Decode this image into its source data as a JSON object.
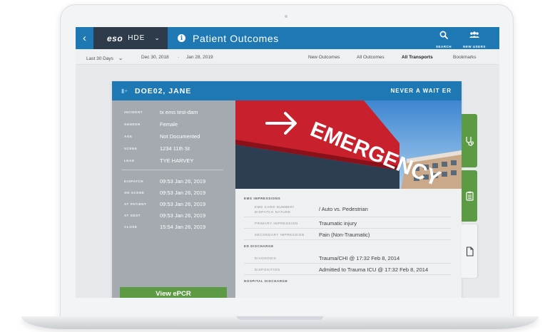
{
  "topbar": {
    "back_icon": "chevron-left-icon",
    "app_logo": "eso",
    "app_product": "HDE",
    "page_title": "Patient Outcomes",
    "actions": [
      {
        "label": "SEARCH",
        "icon": "search-icon"
      },
      {
        "label": "NEW USERS",
        "icon": "users-icon"
      }
    ]
  },
  "filters": {
    "range": "Last 30 Days",
    "start_date": "Dec 30, 2018",
    "separator": "-",
    "end_date": "Jan 28, 2019",
    "tabs": [
      "New Outcomes",
      "All Outcomes",
      "All Transports",
      "Bookmarks"
    ],
    "active_tab": "All Transports"
  },
  "patient": {
    "name": "DOE02, JANE",
    "facility": "NEVER A WAIT ER",
    "fields": [
      {
        "label": "INCIDENT",
        "value": "tx ems test-dam"
      },
      {
        "label": "GENDER",
        "value": "Female"
      },
      {
        "label": "AGE",
        "value": "Not Documented"
      },
      {
        "label": "SCENE",
        "value": "1234 11th St"
      },
      {
        "label": "LEAD",
        "value": "TYE HARVEY"
      }
    ],
    "times": [
      {
        "label": "DISPATCH",
        "value": "09:53 Jan 26, 2019"
      },
      {
        "label": "ON SCENE",
        "value": "09:53 Jan 26, 2019"
      },
      {
        "label": "AT PATIENT",
        "value": "09:53 Jan 26, 2019"
      },
      {
        "label": "AT DEST",
        "value": "09:53 Jan 26, 2019"
      },
      {
        "label": "CLOSE",
        "value": "15:54 Jan 26, 2019"
      }
    ],
    "view_button": "View ePCR"
  },
  "hero": {
    "sign_text": "EMERGENCY"
  },
  "details": {
    "ems_title": "EMS IMPRESSIONS",
    "ems": [
      {
        "label": "EMD CARD NUMBER/ DISPATCH NATURE",
        "value": "/ Auto vs. Pedestrian"
      },
      {
        "label": "PRIMARY IMPRESSION",
        "value": "Traumatic injury"
      },
      {
        "label": "SECONDARY IMPRESSION",
        "value": "Pain (Non-Traumatic)"
      }
    ],
    "ed_title": "ED DISCHARGE",
    "ed": [
      {
        "label": "DIAGNOSIS",
        "value": "Trauma/CHI @ 17:32 Feb 8, 2014"
      },
      {
        "label": "DISPOSITION",
        "value": "Admitted to Trauma ICU @ 17:32 Feb 8, 2014"
      }
    ],
    "hospital_title": "HOSPITAL DISCHARGE"
  },
  "side_tabs": [
    {
      "icon": "stethoscope-icon"
    },
    {
      "icon": "clipboard-icon"
    },
    {
      "icon": "document-icon"
    }
  ],
  "colors": {
    "primary": "#1e78b4",
    "dark": "#2d3b4a",
    "green": "#5c9a44",
    "panel_grey": "#a4aab0"
  }
}
